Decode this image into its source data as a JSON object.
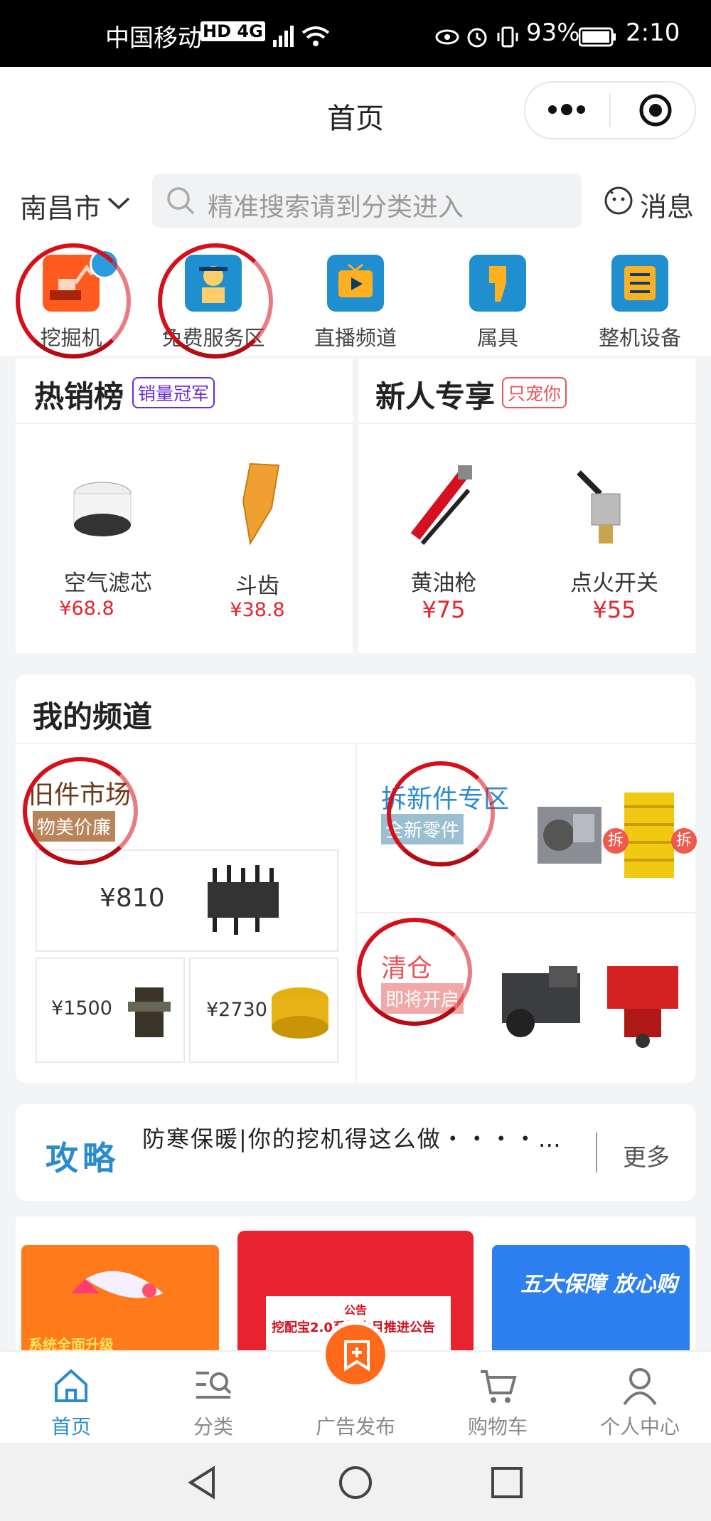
{
  "status_bar": {
    "carrier": "中国移动",
    "network": "HD 4G",
    "battery": "93%",
    "time": "2:10"
  },
  "header": {
    "title": "首页"
  },
  "search": {
    "city": "南昌市",
    "placeholder": "精准搜索请到分类进入",
    "message_label": "消息"
  },
  "icon_nav": [
    {
      "label": "挖掘机",
      "icon": "excavator-icon",
      "color": "#ff5a1f"
    },
    {
      "label": "免费服务区",
      "icon": "mechanic-icon",
      "color": "#1f8fd0"
    },
    {
      "label": "直播频道",
      "icon": "tv-play-icon",
      "color": "#1f8fd0"
    },
    {
      "label": "属具",
      "icon": "attachment-icon",
      "color": "#1f8fd0"
    },
    {
      "label": "整机设备",
      "icon": "list-icon",
      "color": "#1f8fd0"
    }
  ],
  "hot_sale": {
    "title": "热销榜",
    "tag": "销量冠军",
    "items": [
      {
        "name": "空气滤芯",
        "price": "¥68.8"
      },
      {
        "name": "斗齿",
        "price": "¥38.8"
      }
    ]
  },
  "newcomer": {
    "title": "新人专享",
    "tag": "只宠你",
    "items": [
      {
        "name": "黄油枪",
        "price": "¥75"
      },
      {
        "name": "点火开关",
        "price": "¥55"
      }
    ]
  },
  "channel": {
    "title": "我的频道",
    "used_market": {
      "title": "旧件市场",
      "tag": "物美价廉",
      "prices": [
        "¥810",
        "¥1500",
        "¥2730"
      ]
    },
    "dismantled": {
      "title": "拆新件专区",
      "tag": "全新零件",
      "badge": "拆"
    },
    "clearance": {
      "title": "清仓",
      "tag": "即将开启"
    }
  },
  "guide": {
    "logo": "攻略",
    "text": "防寒保暖|你的挖机得这么做・・・・…",
    "more": "更多"
  },
  "banners": [
    {
      "text": "系统全面升级",
      "color": "#ff7a1a"
    },
    {
      "heading": "公告",
      "text": "挖配宝2.0系统本月推进公告",
      "color": "#e8222f"
    },
    {
      "text": "五大保障 放心购",
      "color": "#2d7ff0"
    }
  ],
  "tab_bar": [
    {
      "label": "首页",
      "icon": "home-icon",
      "active": true
    },
    {
      "label": "分类",
      "icon": "category-search-icon",
      "active": false
    },
    {
      "label": "广告发布",
      "icon": "publish-icon",
      "active": false
    },
    {
      "label": "购物车",
      "icon": "cart-icon",
      "active": false
    },
    {
      "label": "个人中心",
      "icon": "person-icon",
      "active": false
    }
  ],
  "colors": {
    "accent": "#1f8fd0",
    "price": "#e0262e",
    "highlight": "#d5101b",
    "publish": "#ff6a1a"
  }
}
